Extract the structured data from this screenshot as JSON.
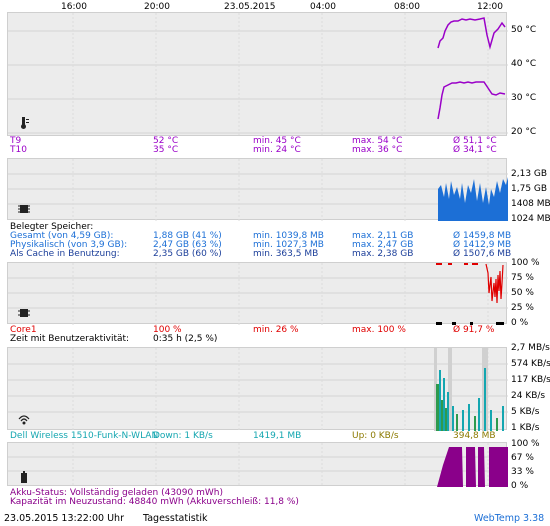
{
  "time_axis": [
    "16:00",
    "20:00",
    "23.05.2015",
    "04:00",
    "08:00",
    "12:00"
  ],
  "temp": {
    "axis": [
      "50 °C",
      "40 °C",
      "30 °C",
      "20 °C"
    ],
    "rows": [
      {
        "name": "T9",
        "cur": "52 °C",
        "min": "min. 45 °C",
        "max": "max. 54 °C",
        "avg": "Ø 51,1 °C"
      },
      {
        "name": "T10",
        "cur": "35 °C",
        "min": "min. 24 °C",
        "max": "max. 36 °C",
        "avg": "Ø 34,1 °C"
      }
    ]
  },
  "memory": {
    "axis": [
      "2,13 GB",
      "1,75 GB",
      "1408 MB",
      "1024 MB"
    ],
    "header": "Belegter Speicher:",
    "rows": [
      {
        "name": "Gesamt (von 4,59 GB):",
        "cur": "1,88 GB (41 %)",
        "min": "min. 1039,8 MB",
        "max": "max. 2,11 GB",
        "avg": "Ø 1459,8 MB"
      },
      {
        "name": "Physikalisch (von 3,9 GB):",
        "cur": "2,47 GB (63 %)",
        "min": "min. 1027,3 MB",
        "max": "max. 2,47 GB",
        "avg": "Ø 1412,9 MB"
      },
      {
        "name": "Als Cache in Benutzung:",
        "cur": "2,35 GB (60 %)",
        "min": "min. 363,5 MB",
        "max": "max. 2,38 GB",
        "avg": "Ø 1507,6 MB"
      }
    ]
  },
  "cpu": {
    "axis": [
      "100 %",
      "75 %",
      "50 %",
      "25 %",
      "0 %"
    ],
    "row": {
      "name": "Core1",
      "cur": "100 %",
      "min": "min. 26 %",
      "max": "max. 100 %",
      "avg": "Ø 91,7 %"
    },
    "activity_label": "Zeit mit Benutzeraktivität:",
    "activity_value": "0:35 h (2,5 %)"
  },
  "network": {
    "axis": [
      "2,7 MB/s",
      "574 KB/s",
      "117 KB/s",
      "24 KB/s",
      "5 KB/s",
      "1 KB/s"
    ],
    "row": {
      "name": "Dell Wireless 1510-Funk-N-WLAN",
      "down": "Down: 1 KB/s",
      "down_total": "1419,1 MB",
      "up": "Up: 0 KB/s",
      "up_total": "394,8 MB"
    }
  },
  "battery": {
    "axis": [
      "100 %",
      "67 %",
      "33 %",
      "0 %"
    ],
    "status": "Akku-Status: Vollständig geladen (43090 mWh)",
    "capacity": "Kapazität im Neuzustand: 48840 mWh (Akkuverschleiß: 11,8 %)"
  },
  "footer": {
    "datetime": "23.05.2015 13:22:00 Uhr",
    "stats_link": "Tagesstatistik",
    "app": "WebTemp 3.38"
  },
  "colors": {
    "temp": "#9a00c8",
    "memory": "#1c6fd6",
    "cpu": "#e00000",
    "network_down": "#14a6b0",
    "network_up": "#2e9a4e",
    "battery": "#8a008a"
  }
}
